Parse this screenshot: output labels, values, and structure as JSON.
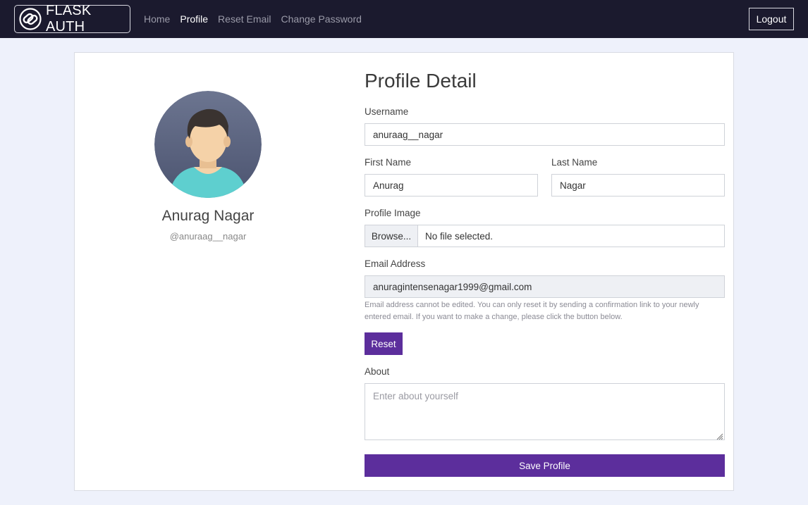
{
  "nav": {
    "brand": "FLASK AUTH",
    "links": [
      "Home",
      "Profile",
      "Reset Email",
      "Change Password"
    ],
    "active": "Profile",
    "logout": "Logout"
  },
  "profile": {
    "name": "Anurag Nagar",
    "handle": "@anuraag__nagar"
  },
  "form": {
    "title": "Profile Detail",
    "username_label": "Username",
    "username_value": "anuraag__nagar",
    "first_name_label": "First Name",
    "first_name_value": "Anurag",
    "last_name_label": "Last Name",
    "last_name_value": "Nagar",
    "profile_image_label": "Profile Image",
    "browse_label": "Browse...",
    "file_status": "No file selected.",
    "email_label": "Email Address",
    "email_value": "anuragintensenagar1999@gmail.com",
    "email_help": "Email address cannot be edited. You can only reset it by sending a confirmation link to your newly entered email. If you want to make a change, please click the button below.",
    "reset_label": "Reset",
    "about_label": "About",
    "about_placeholder": "Enter about yourself",
    "save_label": "Save Profile"
  },
  "colors": {
    "navbar_bg": "#1b1a2e",
    "accent": "#5c2e9c",
    "page_bg": "#eef1fb"
  },
  "icons": {
    "brand_logo": "link-logo-icon",
    "avatar": "user-avatar-icon",
    "resize": "resize-grip-icon"
  }
}
